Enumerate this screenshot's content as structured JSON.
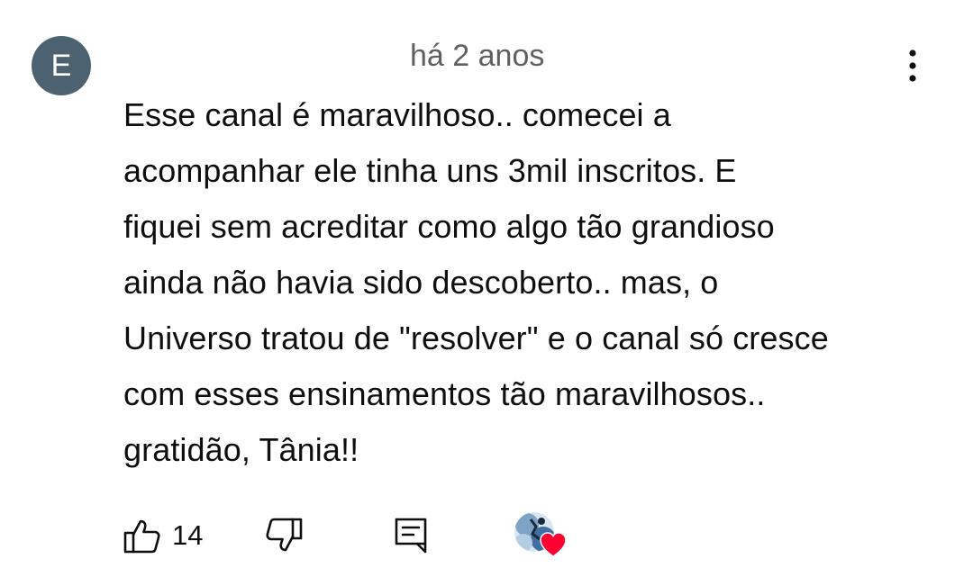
{
  "comment": {
    "author_initial": "E",
    "timestamp": "há 2 anos",
    "text": "Esse canal é maravilhoso.. comecei a\nacompanhar ele tinha uns 3mil inscritos. E\nfiquei sem acreditar como algo tão grandioso\nainda não havia sido descoberto.. mas, o\nUniverso tratou de \"resolver\" e o canal só cresce\ncom esses ensinamentos tão maravilhosos..\ngratidão, Tânia!!",
    "like_count": "14"
  },
  "icons": {
    "menu": "more-vertical-icon",
    "like": "thumbs-up-icon",
    "dislike": "thumbs-down-icon",
    "reply": "comment-reply-icon",
    "creator_heart": "creator-heart-icon"
  },
  "colors": {
    "avatar_bg": "#4d6270",
    "text": "#0f0f0f",
    "secondary_text": "#606060",
    "heart": "#ff0033"
  }
}
